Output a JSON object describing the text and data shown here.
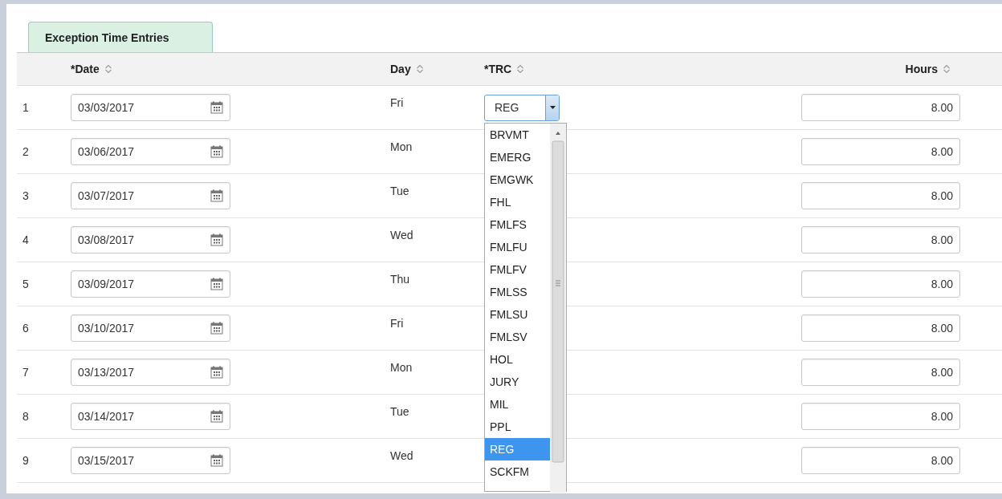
{
  "tabs": [
    {
      "label": "Exception Time Entries",
      "selected": true
    }
  ],
  "table": {
    "columns": [
      {
        "label": "*Date"
      },
      {
        "label": "Day"
      },
      {
        "label": "*TRC"
      },
      {
        "label": "Hours"
      }
    ],
    "rows": [
      {
        "number": "1",
        "date": "03/03/2017",
        "day": "Fri",
        "hours": "8.00"
      },
      {
        "number": "2",
        "date": "03/06/2017",
        "day": "Mon",
        "hours": "8.00"
      },
      {
        "number": "3",
        "date": "03/07/2017",
        "day": "Tue",
        "hours": "8.00"
      },
      {
        "number": "4",
        "date": "03/08/2017",
        "day": "Wed",
        "hours": "8.00"
      },
      {
        "number": "5",
        "date": "03/09/2017",
        "day": "Thu",
        "hours": "8.00"
      },
      {
        "number": "6",
        "date": "03/10/2017",
        "day": "Fri",
        "hours": "8.00"
      },
      {
        "number": "7",
        "date": "03/13/2017",
        "day": "Mon",
        "hours": "8.00"
      },
      {
        "number": "8",
        "date": "03/14/2017",
        "day": "Tue",
        "hours": "8.00"
      },
      {
        "number": "9",
        "date": "03/15/2017",
        "day": "Wed",
        "hours": "8.00"
      }
    ]
  },
  "trc_select": {
    "value": "REG",
    "expanded": true,
    "options": [
      {
        "label": "BRVMT",
        "selected": false
      },
      {
        "label": "EMERG",
        "selected": false
      },
      {
        "label": "EMGWK",
        "selected": false
      },
      {
        "label": "FHL",
        "selected": false
      },
      {
        "label": "FMLFS",
        "selected": false
      },
      {
        "label": "FMLFU",
        "selected": false
      },
      {
        "label": "FMLFV",
        "selected": false
      },
      {
        "label": "FMLSS",
        "selected": false
      },
      {
        "label": "FMLSU",
        "selected": false
      },
      {
        "label": "FMLSV",
        "selected": false
      },
      {
        "label": "HOL",
        "selected": false
      },
      {
        "label": "JURY",
        "selected": false
      },
      {
        "label": "MIL",
        "selected": false
      },
      {
        "label": "PPL",
        "selected": false
      },
      {
        "label": "REG",
        "selected": true
      },
      {
        "label": "SCKFM",
        "selected": false
      }
    ]
  }
}
